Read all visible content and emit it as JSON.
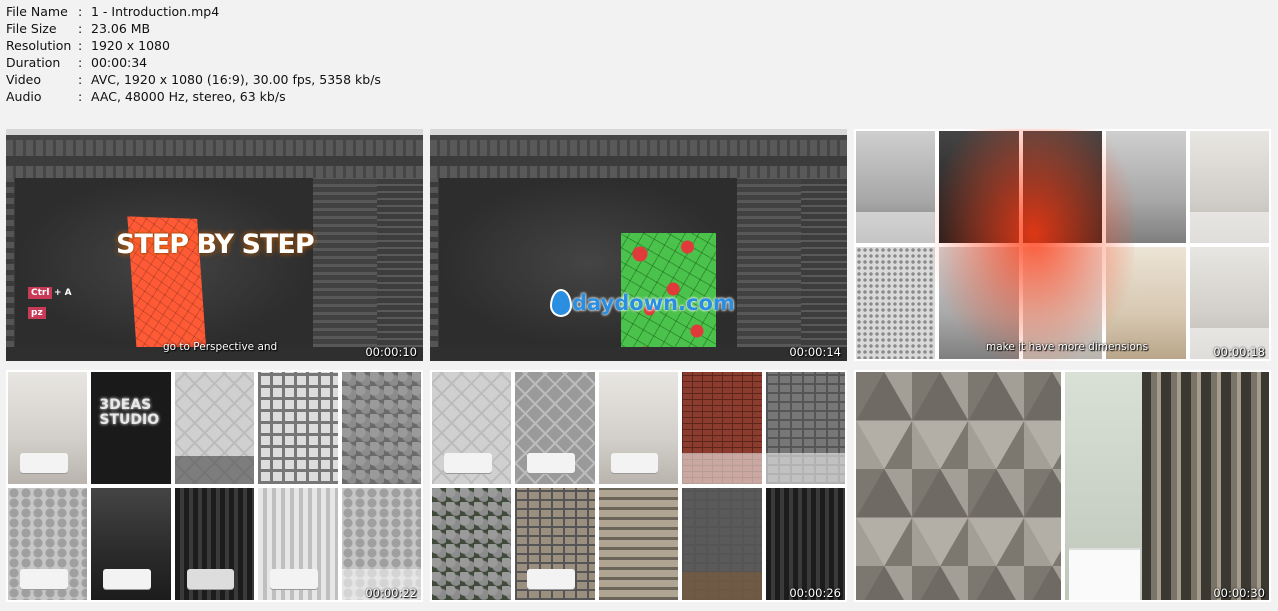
{
  "info": {
    "file_name": {
      "label": "File Name",
      "value": "1 - Introduction.mp4"
    },
    "file_size": {
      "label": "File Size",
      "value": "23.06 MB"
    },
    "resolution": {
      "label": "Resolution",
      "value": "1920 x 1080"
    },
    "duration": {
      "label": "Duration",
      "value": "00:00:34"
    },
    "video": {
      "label": "Video",
      "value": "AVC, 1920 x 1080 (16:9), 30.00 fps, 5358 kb/s"
    },
    "audio": {
      "label": "Audio",
      "value": "AAC, 48000 Hz, stereo, 63 kb/s"
    },
    "separator": ":"
  },
  "thumbnails": [
    {
      "timestamp": "00:00:10",
      "subtitle": "go to Perspective and",
      "overlay_text": "STEP BY STEP",
      "keys": {
        "ctrl": "Ctrl",
        "plus_a": "+ A",
        "pz": "pz"
      }
    },
    {
      "timestamp": "00:00:14",
      "watermark": "daydown.com"
    },
    {
      "timestamp": "00:00:18",
      "subtitle": "make it have more dimensions"
    },
    {
      "timestamp": "00:00:22",
      "neon_text": "3DEAS STUDIO"
    },
    {
      "timestamp": "00:00:26"
    },
    {
      "timestamp": "00:00:30"
    }
  ],
  "colors": {
    "page_bg": "#f2f2f2",
    "max_ui": "#3a3a3a",
    "orange_panel": "#ff5a36",
    "green_panel": "#4bc24b",
    "watermark_blue": "#2a8fe0"
  }
}
